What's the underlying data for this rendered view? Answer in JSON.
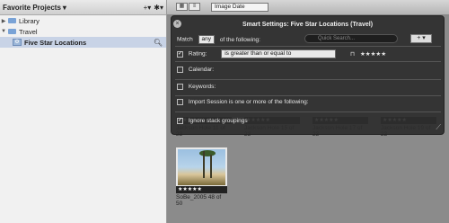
{
  "left_panel": {
    "title": "Favorite Projects",
    "title_arrow": "▾",
    "toolbar_plus": "+▾",
    "toolbar_gear": "✱▾",
    "tree": [
      {
        "label": "Library",
        "indent": 0,
        "open": false
      },
      {
        "label": "Travel",
        "indent": 0,
        "open": true
      },
      {
        "label": "Five Star Locations",
        "indent": 1,
        "selected": true
      }
    ]
  },
  "toolbar": {
    "sort_value": "Image Date"
  },
  "hud": {
    "title": "Smart Settings: Five Star Locations (Travel)",
    "close_symbol": "×",
    "match_label": "Match",
    "match_value": "any",
    "match_suffix": "of the following:",
    "search_placeholder": "Quick Search...",
    "add_symbol": "+ ▾",
    "rating_label": "Rating:",
    "rating_operator": "is greater than or equal to",
    "rating_stars": "★★★★★",
    "calendar_label": "Calendar:",
    "keywords_label": "Keywords:",
    "import_label": "Import Session is one or more of the following:",
    "ignore_label": "Ignore stack groupings"
  },
  "thumbs": [
    {
      "stars": "★★★★★",
      "caption": "Jackson Hole 11 of 23"
    },
    {
      "stars": "★★★★★",
      "caption": "Jackson Hole 15 of 23"
    },
    {
      "stars": "★★★★★",
      "caption": "Jackson Hole 17 of 23"
    },
    {
      "stars": "★★★★★",
      "caption": "Jackson Hole 19 of 23"
    }
  ],
  "bottom_thumb": {
    "stars": "★★★★★",
    "caption": "SoBe_2005 48 of 50"
  }
}
